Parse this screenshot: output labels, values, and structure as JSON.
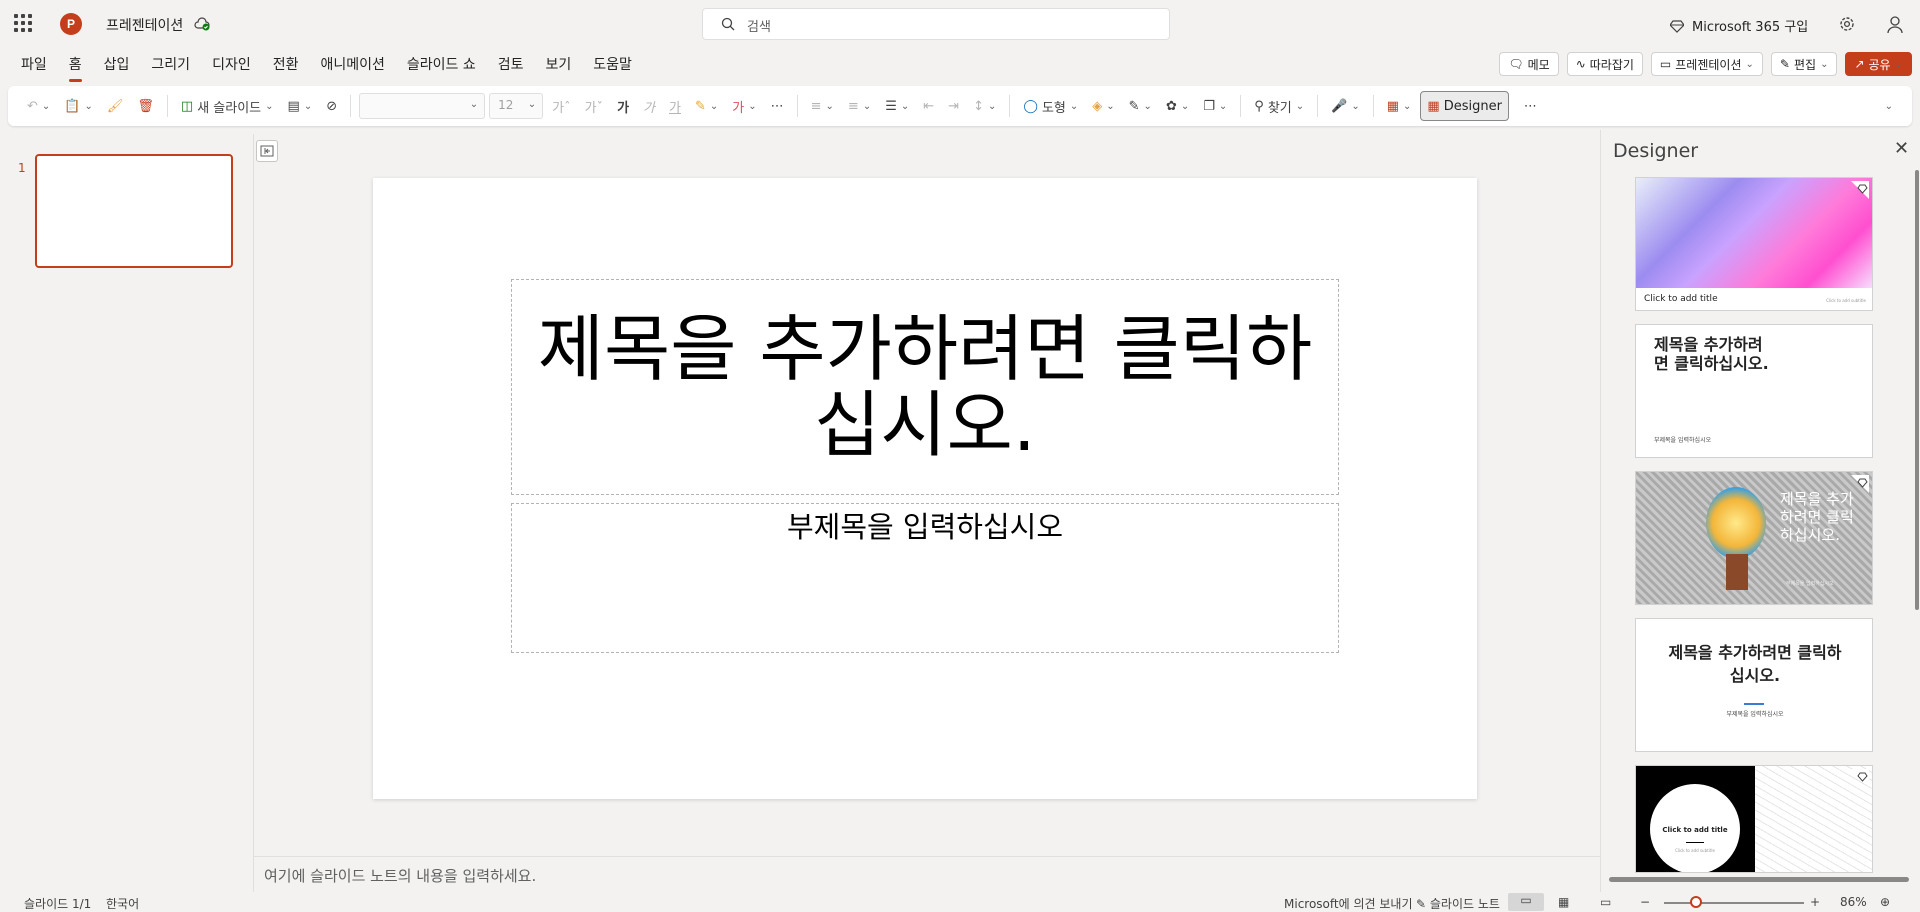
{
  "titlebar": {
    "app_logo_letter": "P",
    "doc_title": "프레젠테이션",
    "search_placeholder": "검색",
    "m365_label": "Microsoft 365 구입"
  },
  "ribbon": {
    "tabs": [
      "파일",
      "홈",
      "삽입",
      "그리기",
      "디자인",
      "전환",
      "애니메이션",
      "슬라이드 쇼",
      "검토",
      "보기",
      "도움말"
    ],
    "active_tab": "홈",
    "right_buttons": {
      "comments": "메모",
      "catchup": "따라잡기",
      "present": "프레젠테이션",
      "editing": "편집",
      "share": "공유"
    },
    "toolbar": {
      "new_slide": "새 슬라이드",
      "font_size": "12",
      "shapes": "도형",
      "find": "찾기",
      "designer": "Designer"
    }
  },
  "thumbnails": {
    "slide_number": "1"
  },
  "slide": {
    "title_placeholder": "제목을 추가하려면 클릭하십시오.",
    "subtitle_placeholder": "부제목을 입력하십시오"
  },
  "notes_placeholder": "여기에 슬라이드 노트의 내용을 입력하세요.",
  "designer": {
    "title": "Designer",
    "cards": [
      {
        "title": "Click to add title",
        "subtitle": "Click to add subtitle"
      },
      {
        "title": "제목을 추가하려면 클릭하십시오.",
        "subtitle": "부제목을 입력하십시오"
      },
      {
        "title": "제목을 추가하려면 클릭하십시오.",
        "subtitle": "부제목을 입력하십시오"
      },
      {
        "title": "제목을 추가하려면 클릭하십시오.",
        "subtitle": "부제목을 입력하십시오"
      },
      {
        "title": "Click to add title",
        "subtitle": "Click to add subtitle"
      }
    ]
  },
  "statusbar": {
    "slide_count": "슬라이드 1/1",
    "language": "한국어",
    "feedback": "Microsoft에 의견 보내기",
    "notes": "슬라이드 노트",
    "zoom": "86%"
  },
  "colors": {
    "accent": "#c43e1c",
    "panel_bg": "#f3f2f1"
  }
}
